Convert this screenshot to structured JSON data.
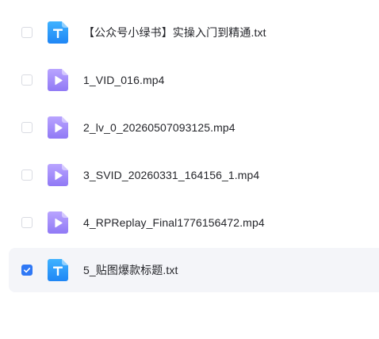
{
  "files": [
    {
      "name": "【公众号小绿书】实操入门到精通.txt",
      "type": "txt",
      "selected": false
    },
    {
      "name": "1_VID_016.mp4",
      "type": "mp4",
      "selected": false
    },
    {
      "name": "2_lv_0_20260507093125.mp4",
      "type": "mp4",
      "selected": false
    },
    {
      "name": "3_SVID_20260331_164156_1.mp4",
      "type": "mp4",
      "selected": false
    },
    {
      "name": "4_RPReplay_Final1776156472.mp4",
      "type": "mp4",
      "selected": false
    },
    {
      "name": "5_贴图爆款标题.txt",
      "type": "txt",
      "selected": true
    }
  ],
  "icons": {
    "txt": "text-file-icon",
    "mp4": "video-file-icon"
  },
  "colors": {
    "txt_icon": "#2f9bff",
    "mp4_icon": "#a78bfa",
    "checkbox_checked": "#2f78f5",
    "selected_row_bg": "#f4f5f9"
  }
}
